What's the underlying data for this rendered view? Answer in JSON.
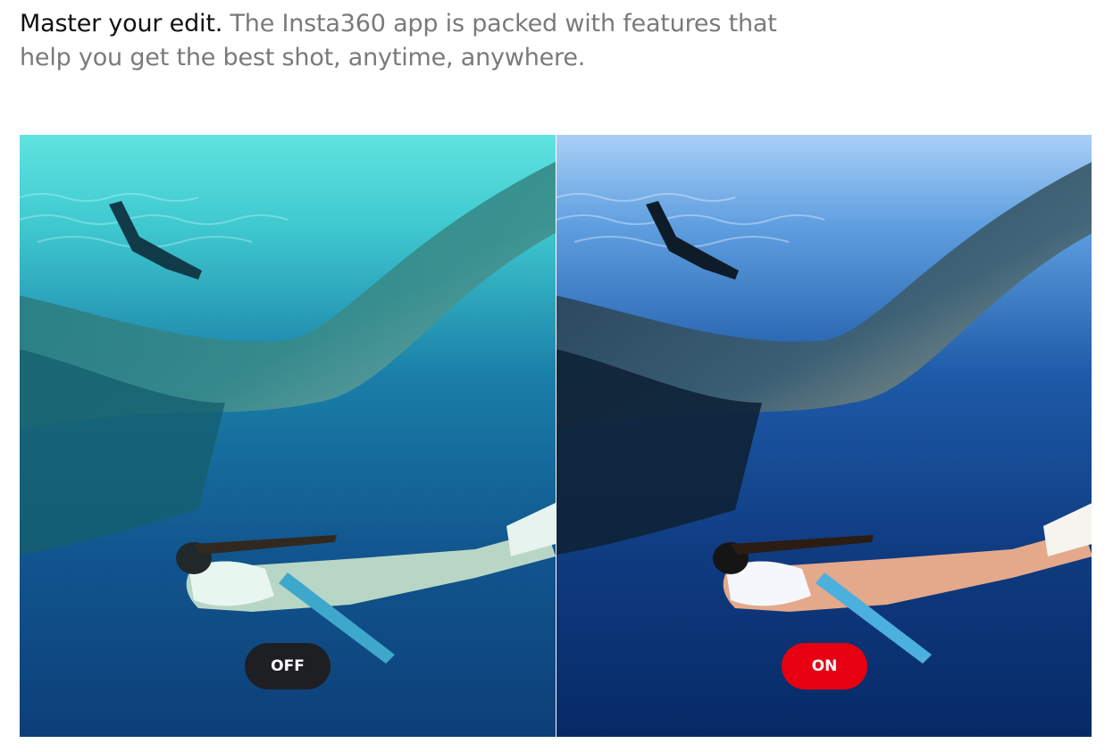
{
  "headline": {
    "lead": "Master your edit.",
    "rest": " The Insta360 app is packed with features that help you get the best shot, anytime, anywhere."
  },
  "comparison": {
    "before": {
      "toggle_label": "OFF",
      "toggle_color": "#1e1f23",
      "water_top": "#5fe3df",
      "water_bottom": "#0d3f78"
    },
    "after": {
      "toggle_label": "ON",
      "toggle_color": "#e60012",
      "water_top": "#a9cff5",
      "water_bottom": "#072a66"
    }
  },
  "colors": {
    "headline_lead": "#111111",
    "headline_rest": "#7a7a7a"
  }
}
